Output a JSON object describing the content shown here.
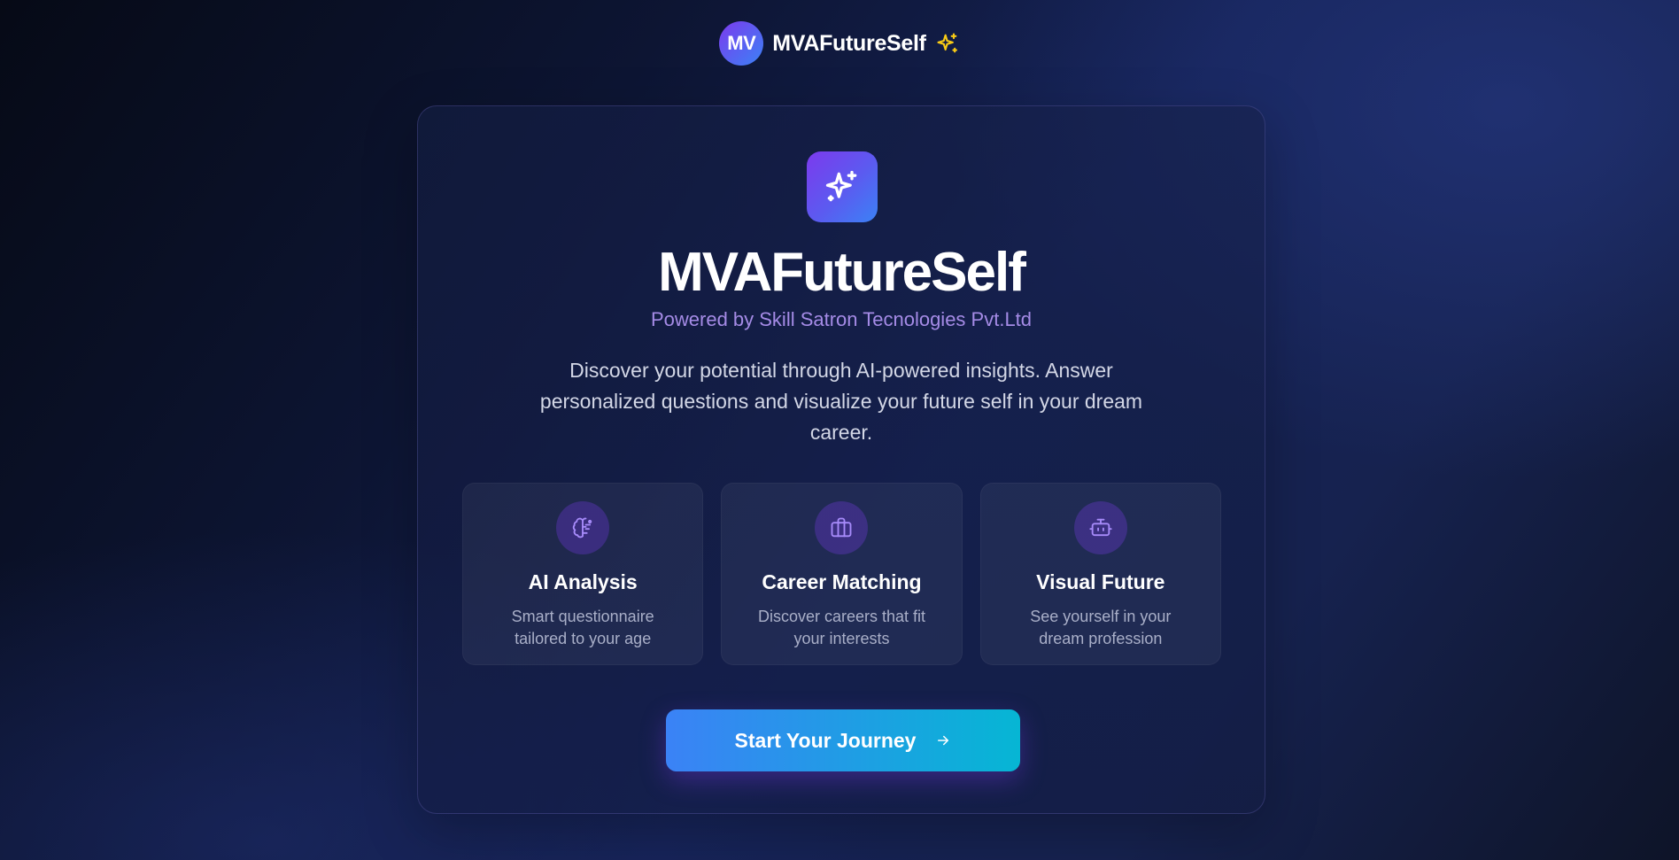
{
  "header": {
    "avatar_initials": "MV",
    "brand_name": "MVAFutureSelf",
    "sparkle_icon": "sparkles-icon"
  },
  "hero": {
    "icon": "sparkles-icon",
    "title": "MVAFutureSelf",
    "subtitle": "Powered by Skill Satron Tecnologies Pvt.Ltd",
    "description": "Discover your potential through AI-powered insights. Answer personalized questions and visualize your future self in your dream career."
  },
  "features": [
    {
      "icon": "brain-icon",
      "title": "AI Analysis",
      "description": "Smart questionnaire tailored to your age"
    },
    {
      "icon": "briefcase-icon",
      "title": "Career Matching",
      "description": "Discover careers that fit your interests"
    },
    {
      "icon": "bot-icon",
      "title": "Visual Future",
      "description": "See yourself in your dream profession"
    }
  ],
  "cta": {
    "label": "Start Your Journey",
    "icon": "arrow-right-icon"
  },
  "colors": {
    "accent_purple": "#7c3aed",
    "accent_blue": "#3b82f6",
    "accent_cyan": "#06b6d4",
    "subtitle": "#a58be6",
    "sparkle_yellow": "#facc15"
  }
}
